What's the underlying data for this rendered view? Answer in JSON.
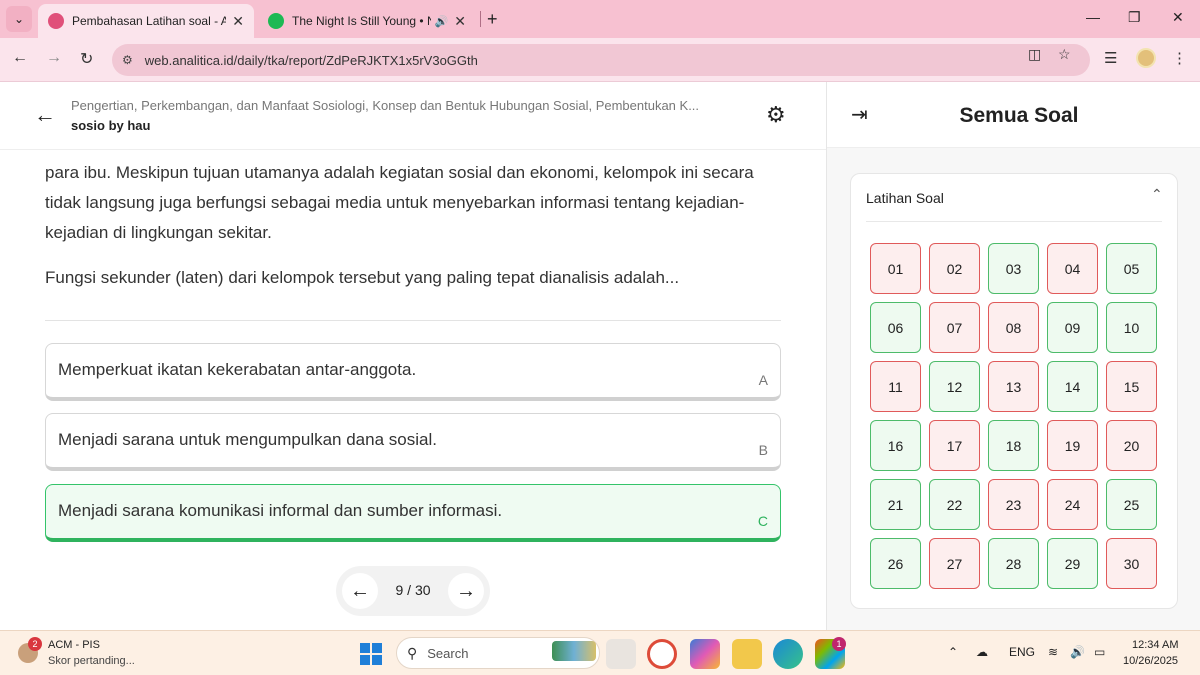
{
  "browser": {
    "tabs": [
      {
        "title": "Pembahasan Latihan soal - Ana",
        "active": true
      },
      {
        "title": "The Night Is Still Young • Ni",
        "active": false
      }
    ],
    "address": {
      "url": "web.analitica.id/daily/tka/report/ZdPeRJKTX1x5rV3oGGth"
    }
  },
  "header": {
    "topic": "Pengertian, Perkembangan, dan Manfaat Sosiologi, Konsep dan Bentuk Hubungan Sosial, Pembentukan K...",
    "group": "sosio by hau"
  },
  "question": {
    "body": "para ibu. Meskipun tujuan utamanya adalah kegiatan sosial dan ekonomi, kelompok ini secara tidak langsung juga berfungsi sebagai media untuk menyebarkan informasi tentang kejadian-kejadian di lingkungan sekitar.",
    "prompt": "Fungsi sekunder (laten) dari kelompok tersebut yang paling tepat dianalisis adalah...",
    "options": [
      {
        "text": "Memperkuat ikatan kekerabatan antar-anggota.",
        "letter": "A"
      },
      {
        "text": "Menjadi sarana untuk mengumpulkan dana sosial.",
        "letter": "B"
      },
      {
        "text": "Menjadi sarana komunikasi informal dan sumber informasi.",
        "letter": "C",
        "selected": true
      }
    ]
  },
  "pager": {
    "label": "9 / 30"
  },
  "panel": {
    "title": "Semua Soal",
    "section": "Latihan Soal",
    "questions": [
      {
        "n": "01",
        "status": "wrong"
      },
      {
        "n": "02",
        "status": "wrong"
      },
      {
        "n": "03",
        "status": "right"
      },
      {
        "n": "04",
        "status": "wrong"
      },
      {
        "n": "05",
        "status": "right"
      },
      {
        "n": "06",
        "status": "right"
      },
      {
        "n": "07",
        "status": "wrong"
      },
      {
        "n": "08",
        "status": "wrong"
      },
      {
        "n": "09",
        "status": "right"
      },
      {
        "n": "10",
        "status": "right"
      },
      {
        "n": "11",
        "status": "wrong"
      },
      {
        "n": "12",
        "status": "right"
      },
      {
        "n": "13",
        "status": "wrong"
      },
      {
        "n": "14",
        "status": "right"
      },
      {
        "n": "15",
        "status": "wrong"
      },
      {
        "n": "16",
        "status": "right"
      },
      {
        "n": "17",
        "status": "wrong"
      },
      {
        "n": "18",
        "status": "right"
      },
      {
        "n": "19",
        "status": "wrong"
      },
      {
        "n": "20",
        "status": "wrong"
      },
      {
        "n": "21",
        "status": "right"
      },
      {
        "n": "22",
        "status": "right"
      },
      {
        "n": "23",
        "status": "wrong"
      },
      {
        "n": "24",
        "status": "wrong"
      },
      {
        "n": "25",
        "status": "right"
      },
      {
        "n": "26",
        "status": "right"
      },
      {
        "n": "27",
        "status": "wrong"
      },
      {
        "n": "28",
        "status": "right"
      },
      {
        "n": "29",
        "status": "right"
      },
      {
        "n": "30",
        "status": "wrong"
      }
    ]
  },
  "taskbar": {
    "news_title": "ACM - PIS",
    "news_sub": "Skor pertanding...",
    "news_badge": "2",
    "search_placeholder": "Search",
    "store_badge": "1",
    "lang": "ENG",
    "time": "12:34 AM",
    "date": "10/26/2025"
  },
  "colors": {
    "correct": "#4dbb6a",
    "wrong": "#e05a5a",
    "tabstrip": "#f7c1d1"
  }
}
